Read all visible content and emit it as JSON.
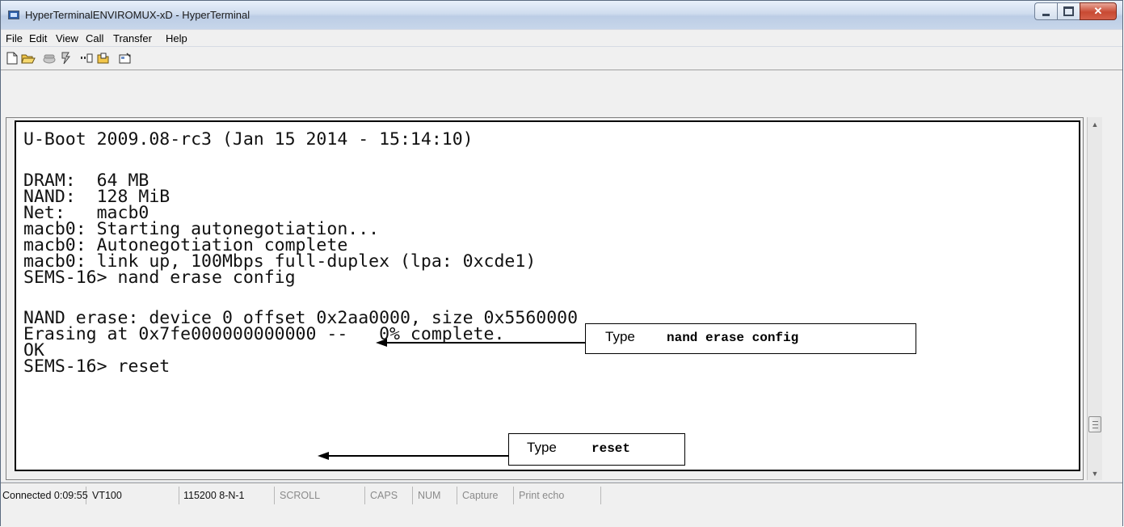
{
  "window": {
    "title": "HyperTerminalENVIROMUX-xD - HyperTerminal"
  },
  "menu": [
    "File",
    "Edit",
    "View",
    "Call",
    "Transfer",
    "Help"
  ],
  "toolbar": [
    "new-document-icon",
    "open-folder-icon",
    "phone-connect-icon",
    "phone-disconnect-icon",
    "send-icon",
    "receive-icon",
    "properties-icon"
  ],
  "terminal": {
    "lines": [
      "U-Boot 2009.08-rc3 (Jan 15 2014 - 15:14:10)",
      "",
      "DRAM:  64 MB",
      "NAND:  128 MiB",
      "Net:   macb0",
      "macb0: Starting autonegotiation...",
      "macb0: Autonegotiation complete",
      "macb0: link up, 100Mbps full-duplex (lpa: 0xcde1)",
      "SEMS-16> nand erase config",
      "",
      "NAND erase: device 0 offset 0x2aa0000, size 0x5560000",
      "Erasing at 0x7fe000000000000 --   0% complete.",
      "OK",
      "SEMS-16> reset"
    ]
  },
  "callouts": [
    {
      "prefix": "Type",
      "command": "nand erase config"
    },
    {
      "prefix": "Type",
      "command": "reset"
    }
  ],
  "status": [
    {
      "label": "Connected 0:09:55"
    },
    {
      "label": "VT100"
    },
    {
      "label": "115200 8-N-1"
    },
    {
      "label": "SCROLL"
    },
    {
      "label": "CAPS"
    },
    {
      "label": "NUM"
    },
    {
      "label": "Capture"
    },
    {
      "label": "Print echo"
    }
  ]
}
